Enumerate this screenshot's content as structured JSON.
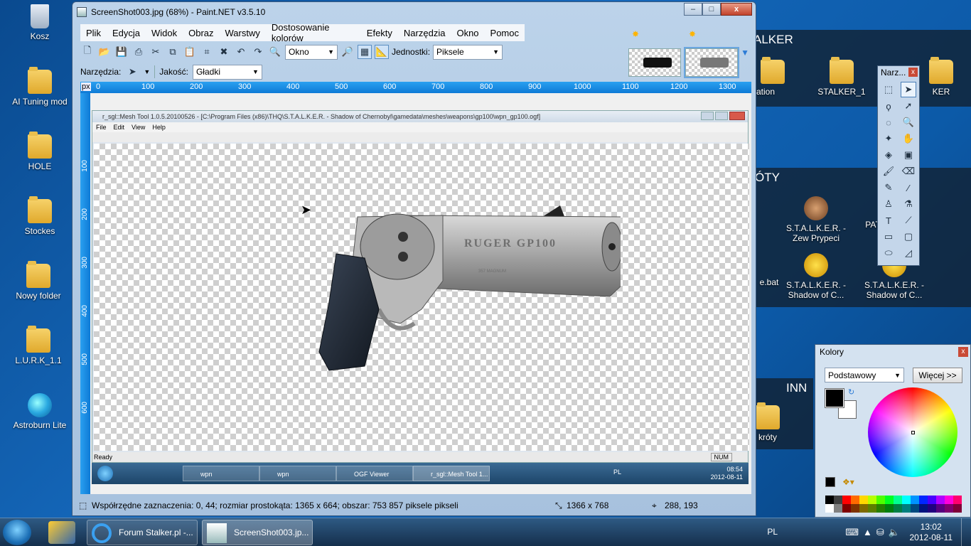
{
  "desktop": {
    "icons": [
      {
        "label": "Kosz"
      },
      {
        "label": "AI Tuning mod"
      },
      {
        "label": "HOLE"
      },
      {
        "label": "Stockes"
      },
      {
        "label": "Nowy folder"
      },
      {
        "label": "L.U.R.K_1.1"
      },
      {
        "label": "Astroburn Lite"
      }
    ],
    "right_icons": [
      {
        "label": "vation"
      },
      {
        "label": "STALKER_1"
      },
      {
        "label": "KER"
      },
      {
        "label": "S.T.A.L.K.E.R. - Zew Prypeci"
      },
      {
        "label": "PAT"
      },
      {
        "label": "e.bat"
      },
      {
        "label": "S.T.A.L.K.E.R. - Shadow of C..."
      },
      {
        "label": "S.T.A.L.K.E.R. - Shadow of C..."
      },
      {
        "label": "króty"
      }
    ],
    "panels": [
      {
        "title": "ALKER"
      },
      {
        "title": "ÓTY"
      },
      {
        "title": "INN"
      }
    ]
  },
  "window": {
    "title": "ScreenShot003.jpg (68%) - Paint.NET v3.5.10",
    "caption_min": "–",
    "caption_max": "□",
    "caption_close": "x"
  },
  "menu": [
    "Plik",
    "Edycja",
    "Widok",
    "Obraz",
    "Warstwy",
    "Dostosowanie kolorów",
    "Efekty",
    "Narzędzia",
    "Okno",
    "Pomoc"
  ],
  "toolbar": {
    "zoom_value": "Okno",
    "units_label": "Jednostki:",
    "units_value": "Piksele",
    "tools_label": "Narzędzia:",
    "quality_label": "Jakość:",
    "quality_value": "Gładki"
  },
  "ruler": {
    "unit": "px",
    "h_ticks": [
      "0",
      "100",
      "200",
      "300",
      "400",
      "500",
      "600",
      "700",
      "800",
      "900",
      "1000",
      "1100",
      "1200",
      "1300"
    ],
    "v_ticks": [
      "100",
      "200",
      "300",
      "400",
      "500",
      "600"
    ]
  },
  "inner": {
    "title": "r_sgl::Mesh Tool 1.0.5.20100526 - [C:\\Program Files (x86)\\THQ\\S.T.A.L.K.E.R. - Shadow of Chernobyl\\gamedata\\meshes\\weapons\\gp100\\wpn_gp100.ogf]",
    "menu": [
      "File",
      "Edit",
      "View",
      "Help"
    ],
    "status": "Ready",
    "num": "NUM",
    "gun_text": "RUGER GP100",
    "gun_caliber": "357 MAGNUM",
    "tasks": [
      "wpn",
      "wpn",
      "OGF Viewer",
      "r_sgl::Mesh Tool 1..."
    ],
    "tray_lang": "PL",
    "tray_time": "08:54",
    "tray_date": "2012-08-11"
  },
  "statusbar": {
    "selection": "Współrzędne zaznaczenia: 0, 44; rozmiar prostokąta: 1365 x 664; obszar: 753 857 piksele pikseli",
    "image_size": "1366 x 768",
    "cursor": "288, 193"
  },
  "tools_window": {
    "title": "Narz..."
  },
  "colors_window": {
    "title": "Kolory",
    "mode": "Podstawowy",
    "more_button": "Więcej >>",
    "primary": "#000000",
    "secondary": "#ffffff",
    "palette": [
      "#000000",
      "#404040",
      "#ff0000",
      "#ff6a00",
      "#ffd800",
      "#b6ff00",
      "#4cff00",
      "#00ff21",
      "#00ff90",
      "#00ffff",
      "#0094ff",
      "#0026ff",
      "#4800ff",
      "#b200ff",
      "#ff00dc",
      "#ff006e",
      "#ffffff",
      "#808080",
      "#7f0000",
      "#7f3300",
      "#7f6a00",
      "#5b7f00",
      "#267f00",
      "#007f0e",
      "#007f46",
      "#007f7f",
      "#004a7f",
      "#00137f",
      "#21007f",
      "#57007f",
      "#7f006e",
      "#7f0037"
    ]
  },
  "taskbar": {
    "tasks": [
      {
        "label": "Forum Stalker.pl -..."
      },
      {
        "label": "ScreenShot003.jp..."
      }
    ],
    "lang": "PL",
    "time": "13:02",
    "date": "2012-08-11"
  }
}
